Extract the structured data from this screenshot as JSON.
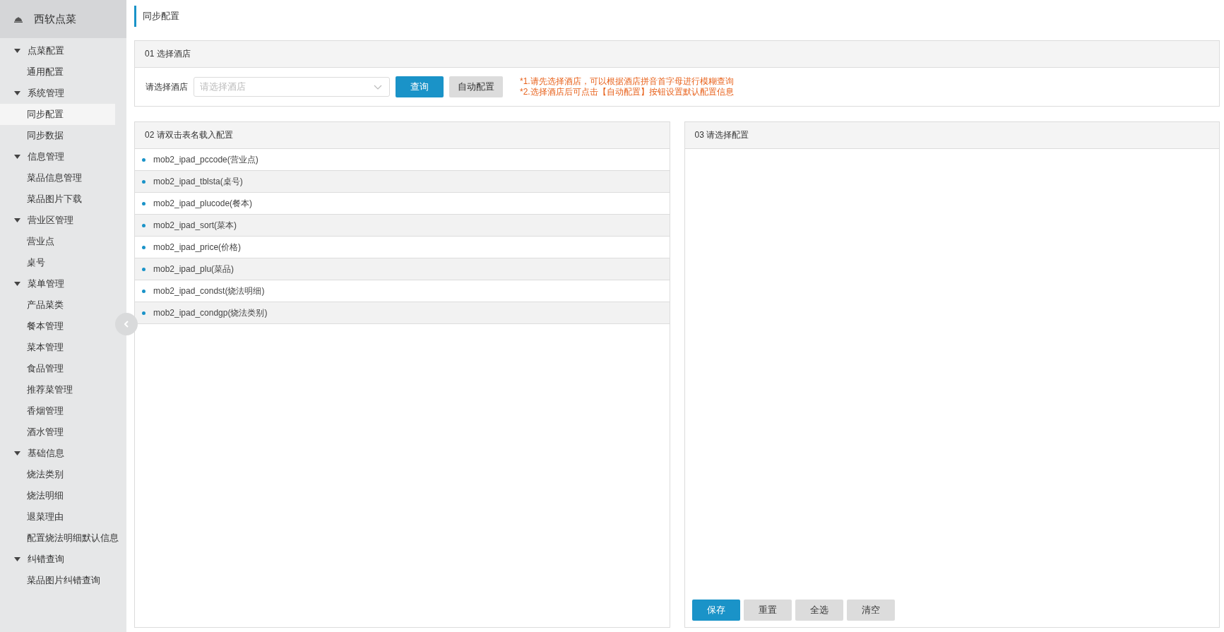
{
  "sidebar": {
    "title": "西软点菜",
    "groups": [
      {
        "label": "点菜配置",
        "expanded": true,
        "children": [
          {
            "label": "通用配置",
            "selected": false
          }
        ]
      },
      {
        "label": "系统管理",
        "expanded": true,
        "children": [
          {
            "label": "同步配置",
            "selected": true
          },
          {
            "label": "同步数据",
            "selected": false
          }
        ]
      },
      {
        "label": "信息管理",
        "expanded": true,
        "children": [
          {
            "label": "菜品信息管理",
            "selected": false
          },
          {
            "label": "菜品图片下载",
            "selected": false
          }
        ]
      },
      {
        "label": "营业区管理",
        "expanded": true,
        "children": [
          {
            "label": "营业点",
            "selected": false
          },
          {
            "label": "桌号",
            "selected": false
          }
        ]
      },
      {
        "label": "菜单管理",
        "expanded": true,
        "children": [
          {
            "label": "产品菜类",
            "selected": false
          },
          {
            "label": "餐本管理",
            "selected": false
          },
          {
            "label": "菜本管理",
            "selected": false
          },
          {
            "label": "食品管理",
            "selected": false
          },
          {
            "label": "推荐菜管理",
            "selected": false
          },
          {
            "label": "香烟管理",
            "selected": false
          },
          {
            "label": "酒水管理",
            "selected": false
          }
        ]
      },
      {
        "label": "基础信息",
        "expanded": true,
        "children": [
          {
            "label": "烧法类别",
            "selected": false
          },
          {
            "label": "烧法明细",
            "selected": false
          },
          {
            "label": "退菜理由",
            "selected": false
          },
          {
            "label": "配置烧法明细默认信息",
            "selected": false
          }
        ]
      },
      {
        "label": "纠错查询",
        "expanded": true,
        "children": [
          {
            "label": "菜品图片纠错查询",
            "selected": false
          }
        ]
      }
    ]
  },
  "breadcrumb": "同步配置",
  "hotel_panel": {
    "title": "01 选择酒店",
    "field_label": "请选择酒店",
    "select": {
      "placeholder": "请选择酒店"
    },
    "buttons": [
      {
        "label": "查询",
        "kind": "primary"
      },
      {
        "label": "自动配置",
        "kind": "default"
      }
    ],
    "notes": [
      "*1.请先选择酒店，可以根据酒店拼音首字母进行模糊查询",
      "*2.选择酒店后可点击【自动配置】按钮设置默认配置信息"
    ]
  },
  "table_panel": {
    "title": "02 请双击表名载入配置",
    "items": [
      "mob2_ipad_pccode(营业点)",
      "mob2_ipad_tblsta(桌号)",
      "mob2_ipad_plucode(餐本)",
      "mob2_ipad_sort(菜本)",
      "mob2_ipad_price(价格)",
      "mob2_ipad_plu(菜品)",
      "mob2_ipad_condst(烧法明细)",
      "mob2_ipad_condgp(烧法类别)"
    ]
  },
  "config_panel": {
    "title": "03 请选择配置",
    "buttons": [
      {
        "label": "保存",
        "kind": "primary"
      },
      {
        "label": "重置",
        "kind": "default"
      },
      {
        "label": "全选",
        "kind": "default"
      },
      {
        "label": "清空",
        "kind": "default"
      }
    ]
  }
}
